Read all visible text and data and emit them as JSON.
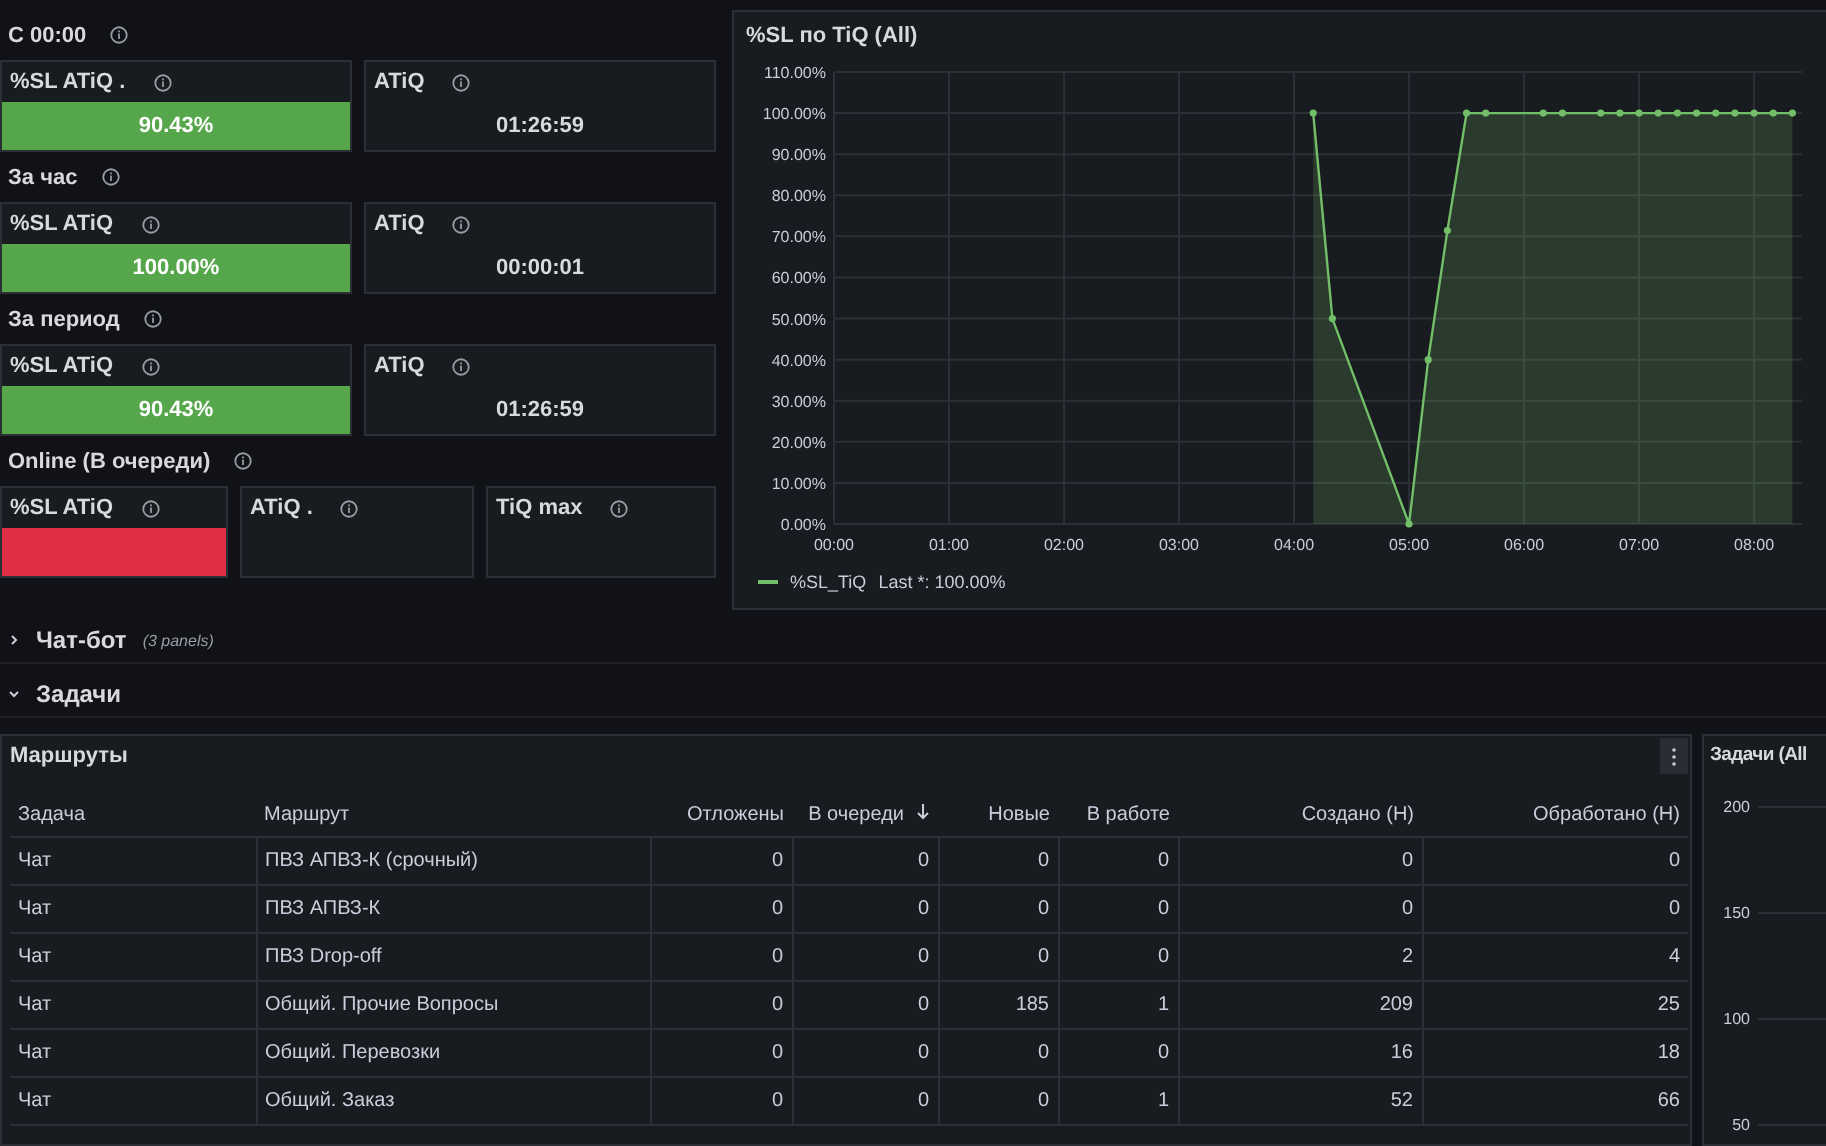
{
  "stat_sections": [
    {
      "title": "С 00:00",
      "panels": [
        {
          "kind": "bar",
          "title": "%SL ATiQ .",
          "value": "90.43%",
          "color": "#56a64b"
        },
        {
          "kind": "text",
          "title": "ATiQ",
          "value": "01:26:59"
        }
      ]
    },
    {
      "title": "За час",
      "panels": [
        {
          "kind": "bar",
          "title": "%SL ATiQ",
          "value": "100.00%",
          "color": "#56a64b"
        },
        {
          "kind": "text",
          "title": "ATiQ",
          "value": "00:00:01"
        }
      ]
    },
    {
      "title": "За период",
      "panels": [
        {
          "kind": "bar",
          "title": "%SL ATiQ",
          "value": "90.43%",
          "color": "#56a64b"
        },
        {
          "kind": "text",
          "title": "ATiQ",
          "value": "01:26:59"
        }
      ]
    },
    {
      "title": "Online (В очереди)",
      "panels": [
        {
          "kind": "bar",
          "title": "%SL ATiQ",
          "color": "#e02f44"
        },
        {
          "kind": "text",
          "title": "ATiQ ."
        },
        {
          "kind": "text",
          "title": "TiQ max"
        }
      ]
    }
  ],
  "sl_chart": {
    "title": "%SL по TiQ (All)",
    "legend_value": "Last *: 100.00%",
    "chart_data": {
      "type": "area",
      "x": [
        250,
        260,
        300,
        310,
        320,
        330,
        340,
        370,
        380,
        400,
        410,
        420,
        430,
        440,
        450,
        460,
        470,
        480,
        490,
        500
      ],
      "series": [
        {
          "name": "%SL_TiQ",
          "color": "#73bf69",
          "values": [
            100,
            50,
            0,
            40,
            71.4,
            100,
            100,
            100,
            100,
            100,
            100,
            100,
            100,
            100,
            100,
            100,
            100,
            100,
            100,
            100
          ]
        }
      ],
      "xlim": [
        0,
        505
      ],
      "ylim": [
        0,
        110
      ],
      "grid": true,
      "xticks": [
        {
          "value": 0,
          "label": "00:00"
        },
        {
          "value": 60,
          "label": "01:00"
        },
        {
          "value": 120,
          "label": "02:00"
        },
        {
          "value": 180,
          "label": "03:00"
        },
        {
          "value": 240,
          "label": "04:00"
        },
        {
          "value": 300,
          "label": "05:00"
        },
        {
          "value": 360,
          "label": "06:00"
        },
        {
          "value": 420,
          "label": "07:00"
        },
        {
          "value": 480,
          "label": "08:00"
        }
      ],
      "yticks": [
        {
          "value": 0,
          "label": "0.00%"
        },
        {
          "value": 10,
          "label": "10.00%"
        },
        {
          "value": 20,
          "label": "20.00%"
        },
        {
          "value": 30,
          "label": "30.00%"
        },
        {
          "value": 40,
          "label": "40.00%"
        },
        {
          "value": 50,
          "label": "50.00%"
        },
        {
          "value": 60,
          "label": "60.00%"
        },
        {
          "value": 70,
          "label": "70.00%"
        },
        {
          "value": 80,
          "label": "80.00%"
        },
        {
          "value": 90,
          "label": "90.00%"
        },
        {
          "value": 100,
          "label": "100.00%"
        },
        {
          "value": 110,
          "label": "110.00%"
        }
      ]
    }
  },
  "rows": [
    {
      "title": "Чат-бот",
      "note": "(3 panels)",
      "expanded": false
    },
    {
      "title": "Задачи",
      "expanded": true
    }
  ],
  "routes_table": {
    "title": "Маршруты",
    "columns": [
      {
        "label": "Задача",
        "sorted": false
      },
      {
        "label": "Маршрут",
        "sorted": false
      },
      {
        "label": "Отложены",
        "sorted": false
      },
      {
        "label": "В очереди",
        "sorted": true
      },
      {
        "label": "Новые",
        "sorted": false
      },
      {
        "label": "В работе",
        "sorted": false
      },
      {
        "label": "Создано (Н)",
        "sorted": false
      },
      {
        "label": "Обработано (Н)",
        "sorted": false
      }
    ],
    "rows": [
      [
        "Чат",
        "ПВЗ АПВЗ-К (срочный)",
        "0",
        "0",
        "0",
        "0",
        "0",
        "0"
      ],
      [
        "Чат",
        "ПВЗ АПВЗ-К",
        "0",
        "0",
        "0",
        "0",
        "0",
        "0"
      ],
      [
        "Чат",
        "ПВЗ Drop-off",
        "0",
        "0",
        "0",
        "0",
        "2",
        "4"
      ],
      [
        "Чат",
        "Общий. Прочие Вопросы",
        "0",
        "0",
        "185",
        "1",
        "209",
        "25"
      ],
      [
        "Чат",
        "Общий. Перевозки",
        "0",
        "0",
        "0",
        "0",
        "16",
        "18"
      ],
      [
        "Чат",
        "Общий. Заказ",
        "0",
        "0",
        "0",
        "1",
        "52",
        "66"
      ]
    ]
  },
  "tasks_panel": {
    "title": "Задачи (All",
    "y_labels": [
      "200",
      "150",
      "100",
      "50"
    ]
  }
}
